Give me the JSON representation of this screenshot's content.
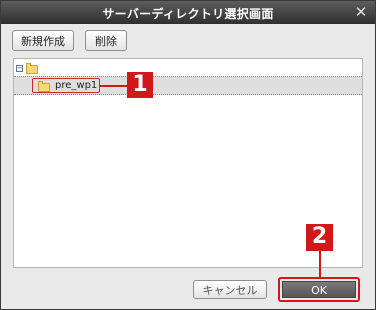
{
  "dialog": {
    "title": "サーバーディレクトリ選択画面",
    "close_glyph": "✕"
  },
  "toolbar": {
    "new_folder_label": "新規作成",
    "delete_label": "削除"
  },
  "tree": {
    "root_expander_glyph": "−",
    "items": [
      {
        "label": "pre_wp1",
        "selected": true
      }
    ]
  },
  "footer": {
    "cancel_label": "キャンセル",
    "ok_label": "OK"
  },
  "annotations": {
    "callout_1": "1",
    "callout_2": "2",
    "color": "#d01818"
  }
}
